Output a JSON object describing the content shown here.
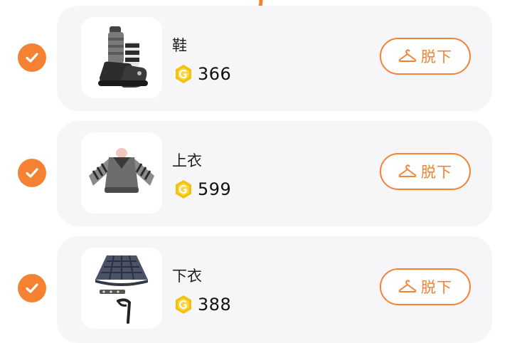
{
  "accent_color": "#f58233",
  "coin_color": "#f4c20d",
  "items": [
    {
      "name": "鞋",
      "price": "366",
      "selected": true,
      "action_label": "脱下",
      "action_icon": "hanger-icon"
    },
    {
      "name": "上衣",
      "price": "599",
      "selected": true,
      "action_label": "脱下",
      "action_icon": "hanger-icon"
    },
    {
      "name": "下衣",
      "price": "388",
      "selected": true,
      "action_label": "脱下",
      "action_icon": "hanger-icon"
    }
  ]
}
